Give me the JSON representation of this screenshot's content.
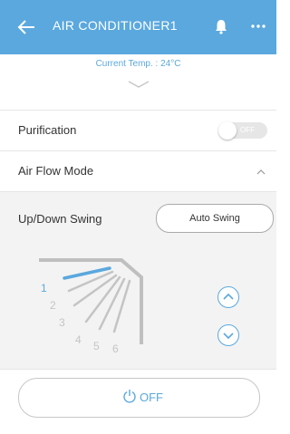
{
  "header": {
    "title": "AIR CONDITIONER1",
    "back_icon": "arrow-left-icon",
    "bell_icon": "bell-icon",
    "more_icon": "more-dots-icon"
  },
  "status": {
    "current_temp": "Current Temp. : 24°C"
  },
  "purification": {
    "label": "Purification",
    "toggle_text": "OFF",
    "state": "off"
  },
  "air_flow": {
    "label": "Air Flow Mode",
    "expanded": true
  },
  "swing": {
    "label": "Up/Down Swing",
    "button_label": "Auto Swing",
    "vane_positions": [
      "1",
      "2",
      "3",
      "4",
      "5",
      "6"
    ],
    "selected_position": "1"
  },
  "power": {
    "label": "OFF",
    "icon": "power-icon"
  },
  "colors": {
    "accent": "#5aa8de",
    "header_bg": "#5aa8de",
    "panel_bg": "#f3f3f3",
    "vane_gray": "#bfbfbf",
    "toggle_off": "#e6e6e6"
  }
}
